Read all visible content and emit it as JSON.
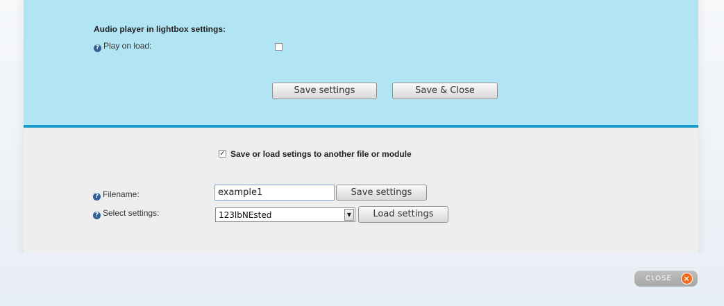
{
  "lightbox_settings": {
    "title": "Audio player in lightbox settings:",
    "play_on_load_label": "Play on load:",
    "play_on_load_checked": false,
    "save_button": "Save settings",
    "save_close_button": "Save & Close"
  },
  "file_settings": {
    "toggle_label": "Save or load setings to another file or module",
    "toggle_checked": true,
    "filename_label": "Filename:",
    "filename_value": "example1",
    "save_button": "Save settings",
    "select_label": "Select settings:",
    "select_value": "123lbNEsted",
    "load_button": "Load settings"
  },
  "footer": {
    "close_label": "CLOSE",
    "close_glyph": "×"
  },
  "icons": {
    "help": "help-icon",
    "checkbox_mark": "✓",
    "dropdown": "▼"
  },
  "colors": {
    "top_panel_bg": "#b1e5f3",
    "divider": "#1b9ac9",
    "bottom_panel_bg": "#eeeeee",
    "close_accent": "#f26b1d"
  }
}
